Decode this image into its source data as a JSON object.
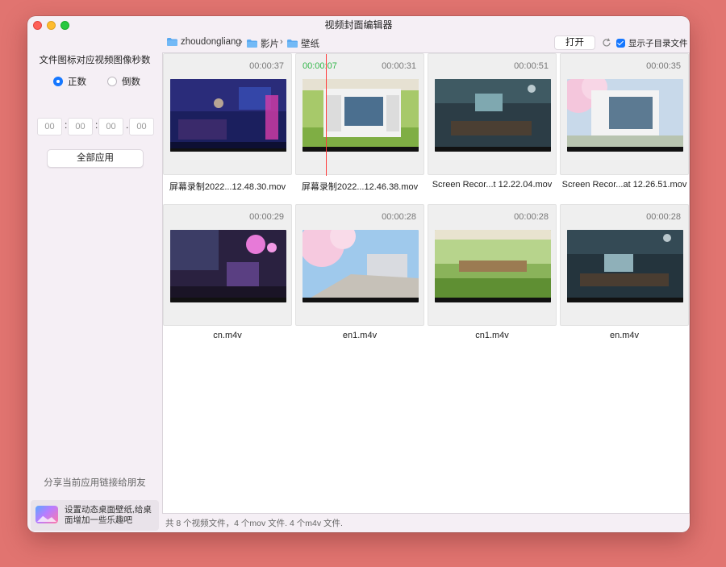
{
  "window": {
    "title": "视频封面编辑器"
  },
  "sidebar": {
    "title": "文件图标对应视频图像秒数",
    "radio_forward": "正数",
    "radio_backward": "倒数",
    "selected": "forward",
    "time_fields": [
      "00",
      "00",
      "00",
      "00"
    ],
    "apply_label": "全部应用",
    "share_label": "分享当前应用链接给朋友",
    "promo_text": "设置动态桌面壁纸,给桌面增加一些乐趣吧"
  },
  "pathbar": {
    "crumbs": [
      "zhoudongliang",
      "影片",
      "壁纸"
    ],
    "open_label": "打开",
    "checkbox_label": "显示子目录文件",
    "checkbox_checked": true
  },
  "files": [
    {
      "duration": "00:00:37",
      "name": "屏幕录制2022...12.48.30.mov",
      "thumb": "neon-room"
    },
    {
      "duration": "00:00:31",
      "name": "屏幕录制2022...12.46.38.mov",
      "thumb": "desktop-anime",
      "marker": "00:00:07",
      "playhead_fraction": 0.23
    },
    {
      "duration": "00:00:51",
      "name": "Screen Recor...t 12.22.04.mov",
      "thumb": "dark-room"
    },
    {
      "duration": "00:00:35",
      "name": "Screen Recor...at 12.26.51.mov",
      "thumb": "sakura-desktop"
    },
    {
      "duration": "00:00:29",
      "name": "cn.m4v",
      "thumb": "neon-gamer"
    },
    {
      "duration": "00:00:28",
      "name": "en1.m4v",
      "thumb": "sakura-street"
    },
    {
      "duration": "00:00:28",
      "name": "cn1.m4v",
      "thumb": "garden-porch"
    },
    {
      "duration": "00:00:28",
      "name": "en.m4v",
      "thumb": "night-desk"
    }
  ],
  "status": "共 8 个视频文件，4 个mov 文件. 4 个m4v 文件.",
  "colors": {
    "background": "#e17470",
    "accent": "#1677ff",
    "marker": "#33b64a",
    "playhead": "#ff3b3b"
  }
}
